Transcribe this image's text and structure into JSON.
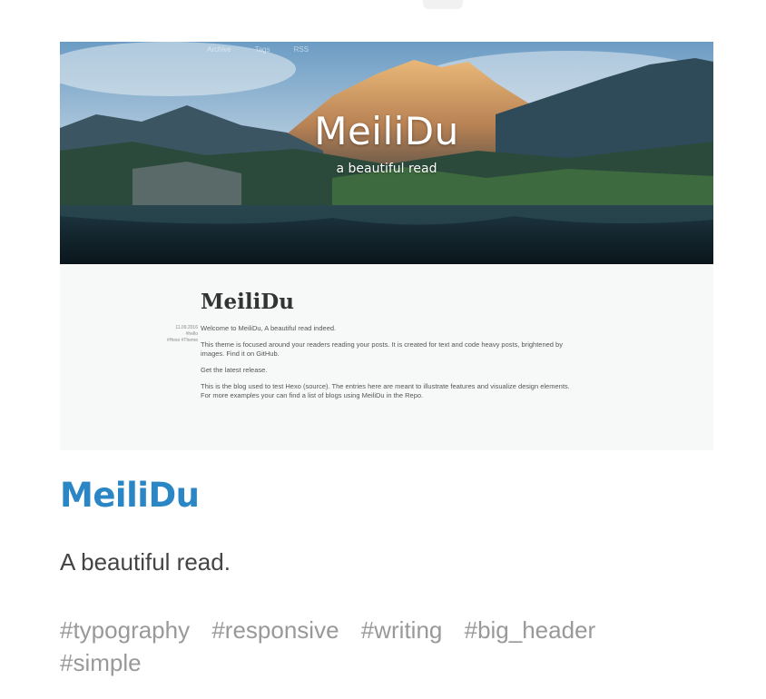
{
  "thumbnail": {
    "nav": [
      "Archive",
      "Tags",
      "RSS"
    ],
    "hero_title": "MeiliDu",
    "hero_subtitle": "a beautiful read",
    "post_title": "MeiliDu",
    "post_meta": [
      "11.09.2016",
      "#hello",
      "#Hexo #Theme"
    ],
    "paragraphs": {
      "p1": "Welcome to MeiliDu, A beautiful read indeed.",
      "p2": "This theme is focused around your readers reading your posts. It is created for text and code heavy posts, brightened by images. Find it on GitHub.",
      "p3": "Get the latest release.",
      "p4a": "This is the blog used to test Hexo (source). The entries here are meant to illustrate features and visualize design elements.",
      "p4b": "For more examples your can find a list of blogs using MeiliDu in the Repo."
    }
  },
  "entry": {
    "title": "MeiliDu",
    "description": "A beautiful read.",
    "tags": [
      "#typography",
      "#responsive",
      "#writing",
      "#big_header",
      "#simple"
    ]
  },
  "colors": {
    "title": "#2b86c5",
    "description": "#444444",
    "tags": "#999999"
  }
}
